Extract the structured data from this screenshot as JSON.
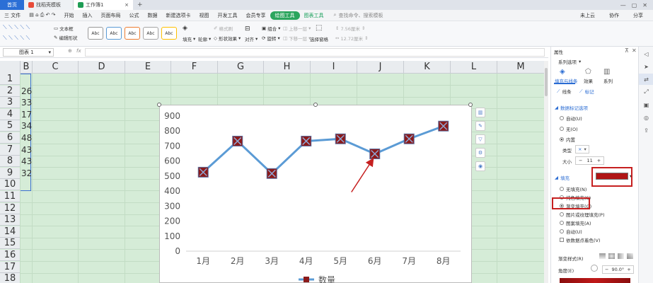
{
  "tabs": [
    {
      "label": "首页"
    },
    {
      "label": "找稻壳模板"
    },
    {
      "label": "工作簿1"
    }
  ],
  "menu": [
    "三 文件",
    "开始",
    "插入",
    "页面布局",
    "公式",
    "数据",
    "新建选项卡",
    "视图",
    "开发工具",
    "会员专享"
  ],
  "menu_green": "绘图工具",
  "menu_teal": "图表工具",
  "search": "查找命令、搜索模板",
  "right_menu": [
    "未上云",
    "协作",
    "分享"
  ],
  "ribbon": {
    "textbox": "文本框",
    "edit_shape": "编辑形状",
    "shape_styles": [
      "Abc",
      "Abc",
      "Abc",
      "Abc",
      "Abc"
    ],
    "fill": "填充",
    "outline": "轮廓",
    "format_painter": "格式刷",
    "shape_effect": "形状效果",
    "align": "对齐",
    "group": "组合",
    "rotate": "旋转",
    "bring_forward": "上移一层",
    "send_back": "下移一层",
    "select_pane": "选择窗格",
    "height": "7.56厘米",
    "width": "12.72厘米"
  },
  "namebox": "图表 1",
  "fx": "fx",
  "columns": [
    "B",
    "C",
    "D",
    "E",
    "F",
    "G",
    "H",
    "I",
    "J",
    "K",
    "L",
    "M"
  ],
  "rows": [
    "1",
    "2",
    "3",
    "4",
    "5",
    "6",
    "7",
    "8",
    "9",
    "10",
    "11",
    "12",
    "13",
    "14",
    "15",
    "16",
    "17",
    "18"
  ],
  "colB_values": [
    "26",
    "33",
    "17",
    "34",
    "48",
    "43",
    "43",
    "32"
  ],
  "chart_data": {
    "type": "line",
    "categories": [
      "1月",
      "2月",
      "3月",
      "4月",
      "5月",
      "6月",
      "7月",
      "8月"
    ],
    "series": [
      {
        "name": "数量",
        "values": [
          526,
          733,
          517,
          733,
          748,
          648,
          748,
          833
        ]
      }
    ],
    "ylim": [
      0,
      900
    ],
    "yticks": [
      "0",
      "100",
      "200",
      "300",
      "400",
      "500",
      "600",
      "700",
      "800",
      "900"
    ],
    "grid": false,
    "legend": "bottom",
    "line_color": "#5b9bd5",
    "marker_color": "#8b1a1a"
  },
  "panel": {
    "title": "属性",
    "series_option": "系列选项",
    "tabs": [
      "填充与线条",
      "效果",
      "系列"
    ],
    "sub_tabs": [
      "线条",
      "标记"
    ],
    "marker_options": "数据标记选项",
    "auto": "自动(U)",
    "none": "无(O)",
    "builtin": "内置",
    "type_label": "类型",
    "type_value": "×",
    "size_label": "大小",
    "size_value": "11",
    "fill_label": "填充",
    "no_fill": "无填充(N)",
    "solid_fill": "纯色填充(S)",
    "gradient_fill": "渐变填充(G)",
    "picture_fill": "图片或纹理填充(P)",
    "pattern_fill": "图案填充(A)",
    "auto_fill": "自动(U)",
    "vary_colors": "依数据点着色(V)",
    "gradient_style": "渐变样式(R)",
    "angle_label": "角度(E)",
    "angle_value": "90.0°",
    "fill_color": "#b01515"
  }
}
